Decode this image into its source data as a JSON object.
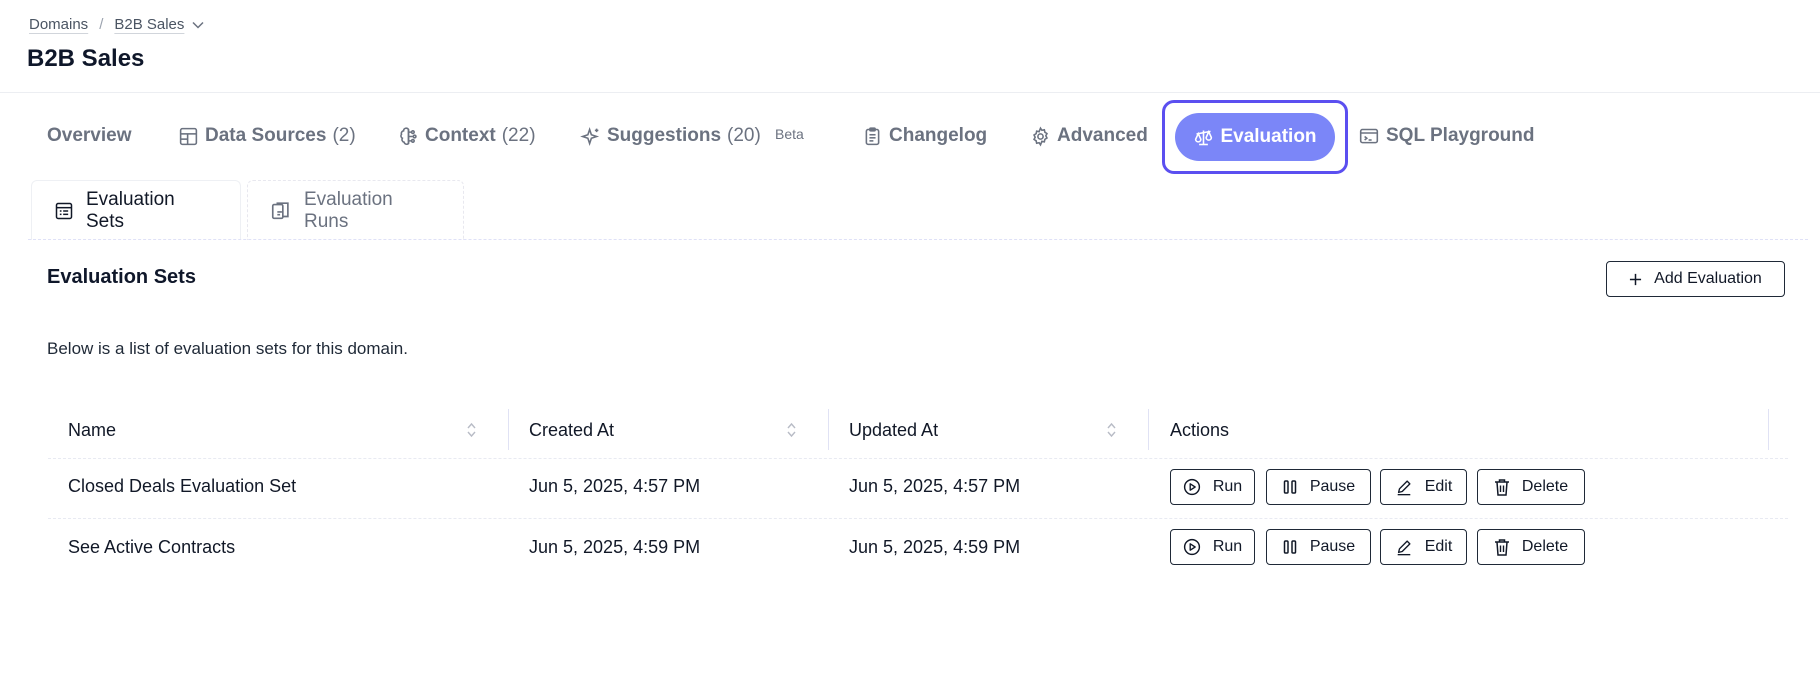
{
  "breadcrumb": {
    "root": "Domains",
    "separator": "/",
    "current": "B2B Sales"
  },
  "page": {
    "title": "B2B Sales"
  },
  "tabs": [
    {
      "label": "Overview",
      "count": ""
    },
    {
      "label": "Data Sources",
      "count": "(2)"
    },
    {
      "label": "Context",
      "count": "(22)"
    },
    {
      "label": "Suggestions",
      "count": "(20)",
      "badge": "Beta"
    },
    {
      "label": "Changelog",
      "count": ""
    },
    {
      "label": "Advanced",
      "count": ""
    },
    {
      "label": "Evaluation",
      "count": "",
      "active": true
    },
    {
      "label": "SQL Playground",
      "count": ""
    }
  ],
  "subtabs": [
    {
      "label": "Evaluation Sets",
      "active": true
    },
    {
      "label": "Evaluation Runs",
      "active": false
    }
  ],
  "panel": {
    "title": "Evaluation Sets",
    "add_button": "Add Evaluation",
    "description": "Below is a list of evaluation sets for this domain."
  },
  "table": {
    "columns": [
      "Name",
      "Created At",
      "Updated At",
      "Actions"
    ],
    "actions": [
      "Run",
      "Pause",
      "Edit",
      "Delete"
    ],
    "rows": [
      {
        "name": "Closed Deals Evaluation Set",
        "created": "Jun 5, 2025, 4:57 PM",
        "updated": "Jun 5, 2025, 4:57 PM"
      },
      {
        "name": "See Active Contracts",
        "created": "Jun 5, 2025, 4:59 PM",
        "updated": "Jun 5, 2025, 4:59 PM"
      }
    ]
  },
  "colors": {
    "accent": "#7b86f8",
    "focus_ring": "#5b4ff0",
    "muted_text": "#6b7280",
    "border": "#1f2937"
  },
  "icons": {
    "tabs": [
      "table-layout-icon",
      "brain-circuit-icon",
      "sparkles-icon",
      "clipboard-icon",
      "gear-icon",
      "scale-icon",
      "terminal-window-icon"
    ],
    "subtabs": [
      "calendar-table-icon",
      "copy-files-icon"
    ],
    "actions": [
      "play-circle-icon",
      "pause-icon",
      "pencil-icon",
      "trash-icon"
    ]
  }
}
